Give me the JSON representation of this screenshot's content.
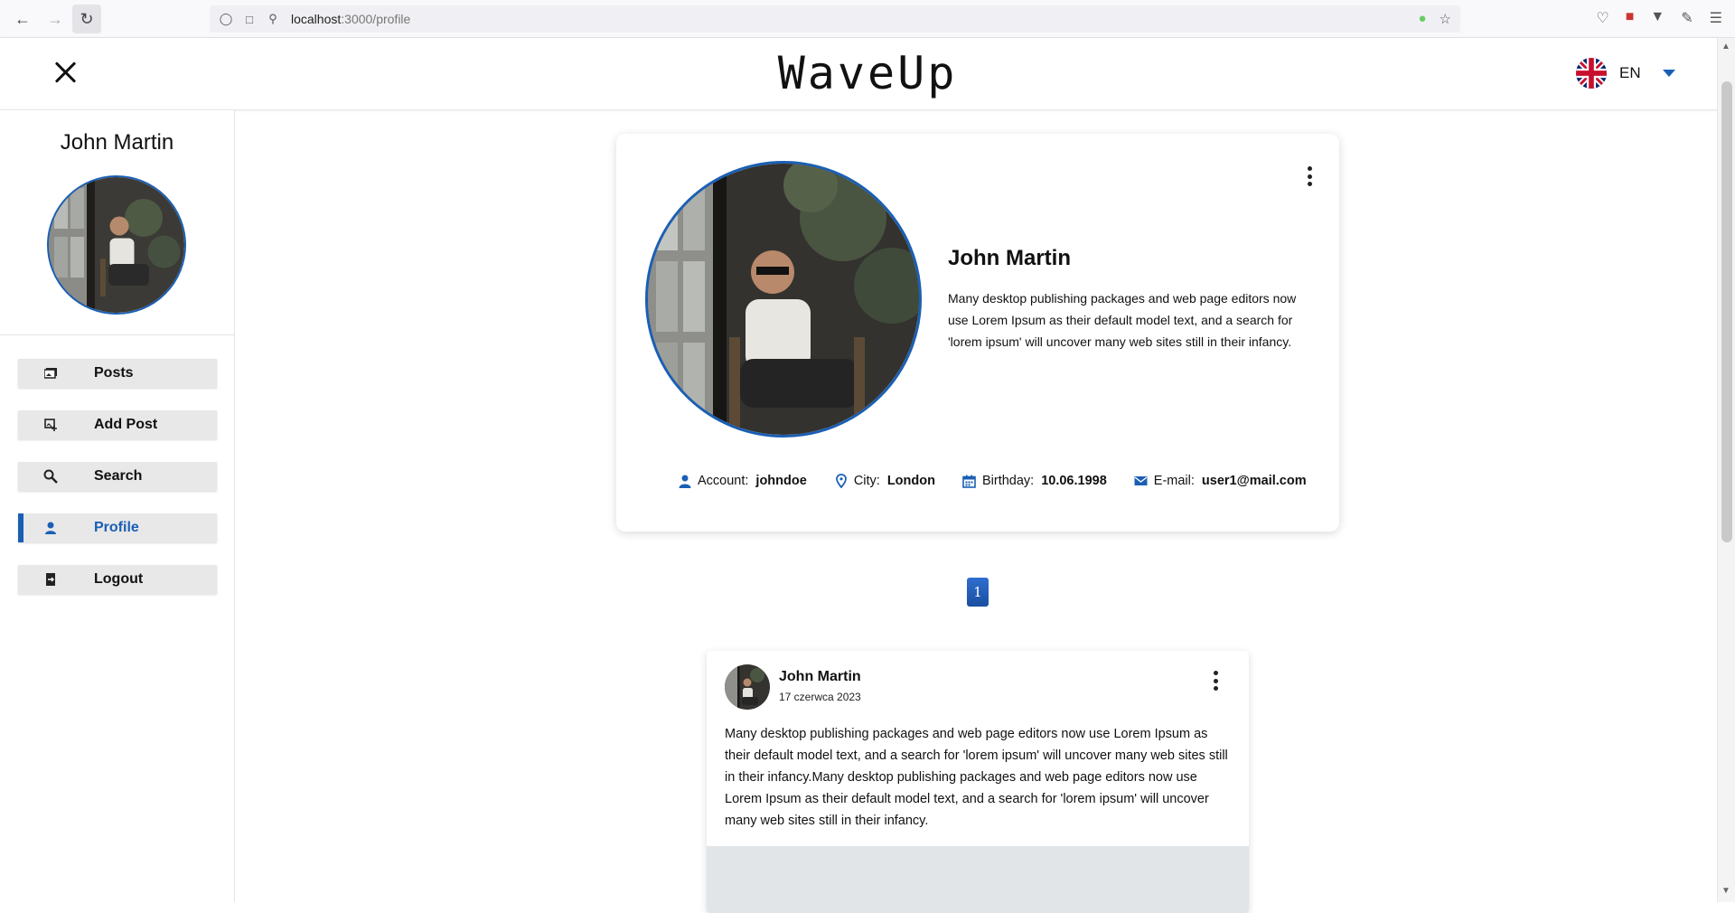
{
  "browser": {
    "url_host": "localhost",
    "url_path": ":3000/profile"
  },
  "header": {
    "logo": "WaveUp",
    "language": "EN"
  },
  "sidebar": {
    "user_name": "John Martin",
    "menu": [
      {
        "label": "Posts",
        "icon": "image-icon"
      },
      {
        "label": "Add Post",
        "icon": "add-image-icon"
      },
      {
        "label": "Search",
        "icon": "search-icon"
      },
      {
        "label": "Profile",
        "icon": "person-icon",
        "active": true
      },
      {
        "label": "Logout",
        "icon": "logout-icon"
      }
    ]
  },
  "profile": {
    "name": "John Martin",
    "bio": "Many desktop publishing packages and web page editors now use Lorem Ipsum as their default model text, and a search for 'lorem ipsum' will uncover many web sites still in their infancy.",
    "info": {
      "account_label": "Account:",
      "account_value": "johndoe",
      "city_label": "City:",
      "city_value": "London",
      "birthday_label": "Birthday:",
      "birthday_value": "10.06.1998",
      "email_label": "E-mail:",
      "email_value": "user1@mail.com"
    }
  },
  "pagination": {
    "current_page": "1"
  },
  "post": {
    "author": "John Martin",
    "date": "17 czerwca 2023",
    "text": "Many desktop publishing packages and web page editors now use Lorem Ipsum as their default model text, and a search for 'lorem ipsum' will uncover many web sites still in their infancy.Many desktop publishing packages and web page editors now use Lorem Ipsum as their default model text, and a search for 'lorem ipsum' will uncover many web sites still in their infancy."
  },
  "colors": {
    "accent": "#1a5fb4",
    "menu_bg": "#e8e8e8"
  }
}
